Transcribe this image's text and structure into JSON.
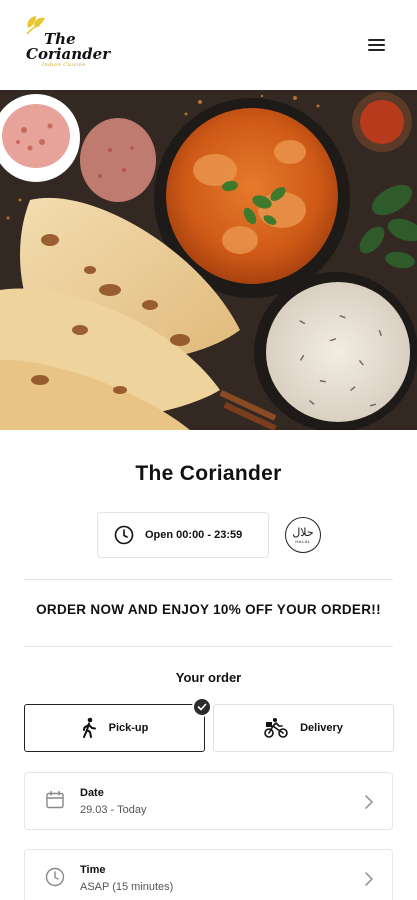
{
  "header": {
    "logo": {
      "line1": "The",
      "line2": "Coriander",
      "tagline": "Indian Cuisine"
    },
    "menu_icon": "hamburger-menu-icon"
  },
  "hero": {
    "alt": "Curry, naan bread and rice"
  },
  "restaurant": {
    "name": "The Coriander",
    "hours": "Open 00:00 - 23:59",
    "hours_icon": "clock-icon",
    "halal_badge": {
      "arabic": "حلال",
      "label": "HALAL"
    }
  },
  "promo": "ORDER NOW AND ENJOY 10% OFF YOUR ORDER!!",
  "order": {
    "heading": "Your order",
    "options": [
      {
        "label": "Pick-up",
        "icon": "walking-person-icon",
        "selected": true
      },
      {
        "label": "Delivery",
        "icon": "bicycle-delivery-icon",
        "selected": false
      }
    ],
    "date": {
      "label": "Date",
      "value": "29.03 - Today",
      "icon": "calendar-icon"
    },
    "time": {
      "label": "Time",
      "value": "ASAP (15 minutes)",
      "icon": "clock-icon"
    }
  },
  "colors": {
    "accent": "#e9c62e",
    "curry": "#d9661f",
    "dark": "#2b2b2b"
  }
}
